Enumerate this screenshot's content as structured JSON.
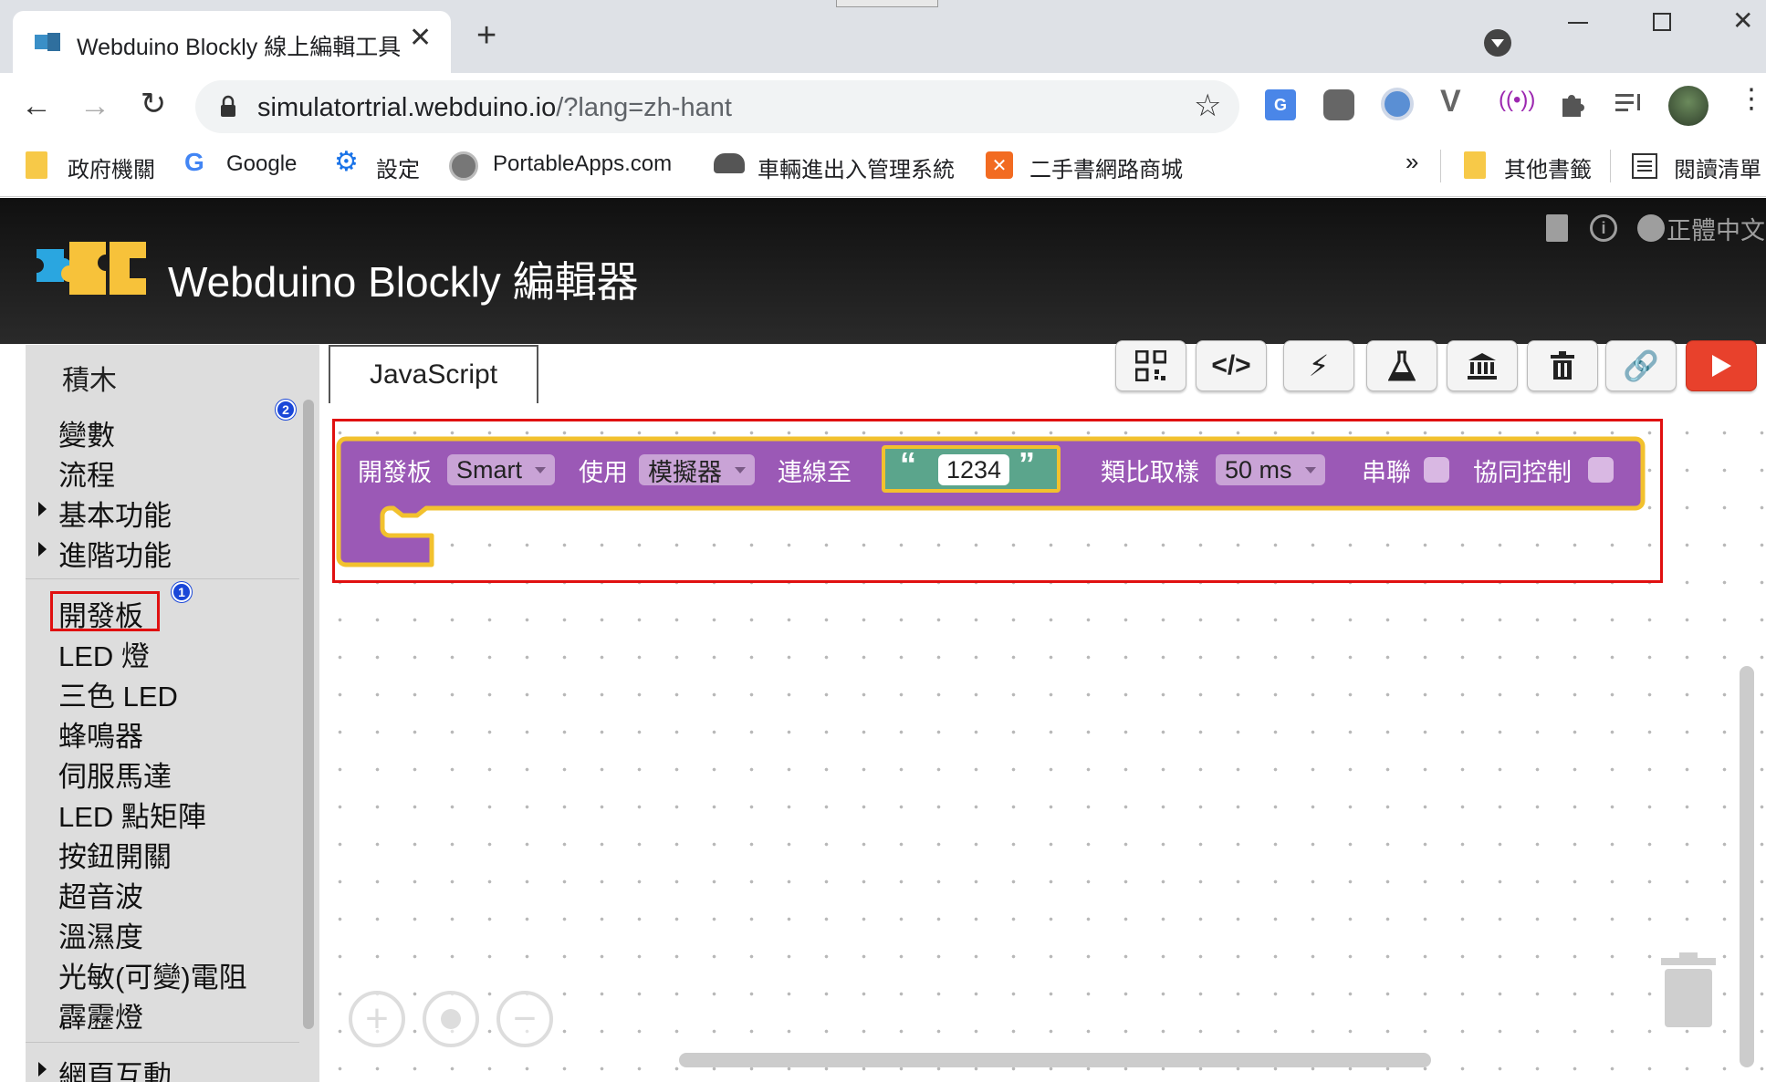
{
  "browser": {
    "tab_title": "Webduino Blockly 線上編輯工具",
    "new_tab": "+",
    "url_host": "simulatortrial.webduino.io",
    "url_path": "/?lang=zh-hant",
    "bookmarks": [
      "政府機關",
      "Google",
      "設定",
      "PortableApps.com",
      "車輛進出入管理系統",
      "二手書網路商城"
    ],
    "more_bookmarks": "»",
    "other_bookmarks": "其他書籤",
    "reading_list": "閱讀清單"
  },
  "app": {
    "title": "Webduino Blockly 編輯器",
    "language": "正體中文"
  },
  "toolbox": {
    "title": "積木",
    "categories_top": [
      {
        "label": "變數",
        "expandable": false
      },
      {
        "label": "流程",
        "expandable": false
      },
      {
        "label": "基本功能",
        "expandable": true
      },
      {
        "label": "進階功能",
        "expandable": true
      }
    ],
    "categories_devices": [
      "開發板",
      "LED 燈",
      "三色 LED",
      "蜂鳴器",
      "伺服馬達",
      "LED 點矩陣",
      "按鈕開關",
      "超音波",
      "溫濕度",
      "光敏(可變)電阻",
      "霹靂燈"
    ],
    "partial_item": "網頁互動",
    "badge_1": "1",
    "badge_2": "2"
  },
  "workspace": {
    "tab_label": "JavaScript",
    "toolbar_icons": [
      "qr-code-icon",
      "code-icon",
      "lightning-icon",
      "flask-icon",
      "bank-icon",
      "trash-icon",
      "link-icon",
      "play-icon"
    ]
  },
  "block": {
    "label_board": "開發板",
    "board_type": "Smart",
    "label_use": "使用",
    "mode": "模擬器",
    "label_connect": "連線至",
    "open_quote": "“",
    "device_id": "1234",
    "close_quote": "”",
    "label_sampling": "類比取樣",
    "sampling": "50 ms",
    "label_serial": "串聯",
    "label_cooperative": "協同控制"
  },
  "colors": {
    "block_purple": "#9b59b6",
    "block_highlight": "#f2c12e",
    "text_block_green": "#5ba58c",
    "annotation_red": "#e01010",
    "run_button": "#e8412c"
  }
}
